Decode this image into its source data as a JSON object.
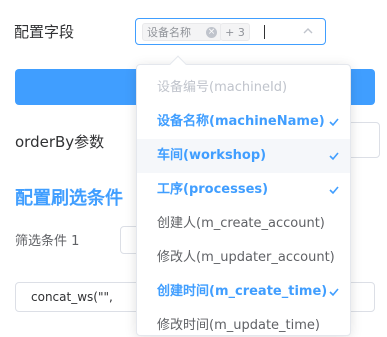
{
  "form": {
    "field_label": "配置字段",
    "tag_first": "设备名称",
    "tag_more": "+ 3",
    "orderby_label": "orderBy参数",
    "section_title": "配置刷选条件",
    "filter_label": "筛选条件 1",
    "concat_value": "concat_ws(\"\","
  },
  "dropdown": {
    "options": [
      {
        "label": "设备编号(machineId)",
        "state": "disabled"
      },
      {
        "label": "设备名称(machineName)",
        "state": "selected"
      },
      {
        "label": "车间(workshop)",
        "state": "selected-hover"
      },
      {
        "label": "工序(processes)",
        "state": "selected"
      },
      {
        "label": "创建人(m_create_account)",
        "state": "normal"
      },
      {
        "label": "修改人(m_updater_account)",
        "state": "normal"
      },
      {
        "label": "创建时间(m_create_time)",
        "state": "selected"
      },
      {
        "label": "修改时间(m_update_time)",
        "state": "normal"
      }
    ]
  },
  "colors": {
    "accent": "#409eff",
    "hover_bg": "#f5f7fa",
    "disabled": "#c0c4cc"
  },
  "icons": {
    "tag_close": "close-circle-icon",
    "select_arrow": "chevron-up-icon",
    "selected_mark": "check-icon"
  }
}
